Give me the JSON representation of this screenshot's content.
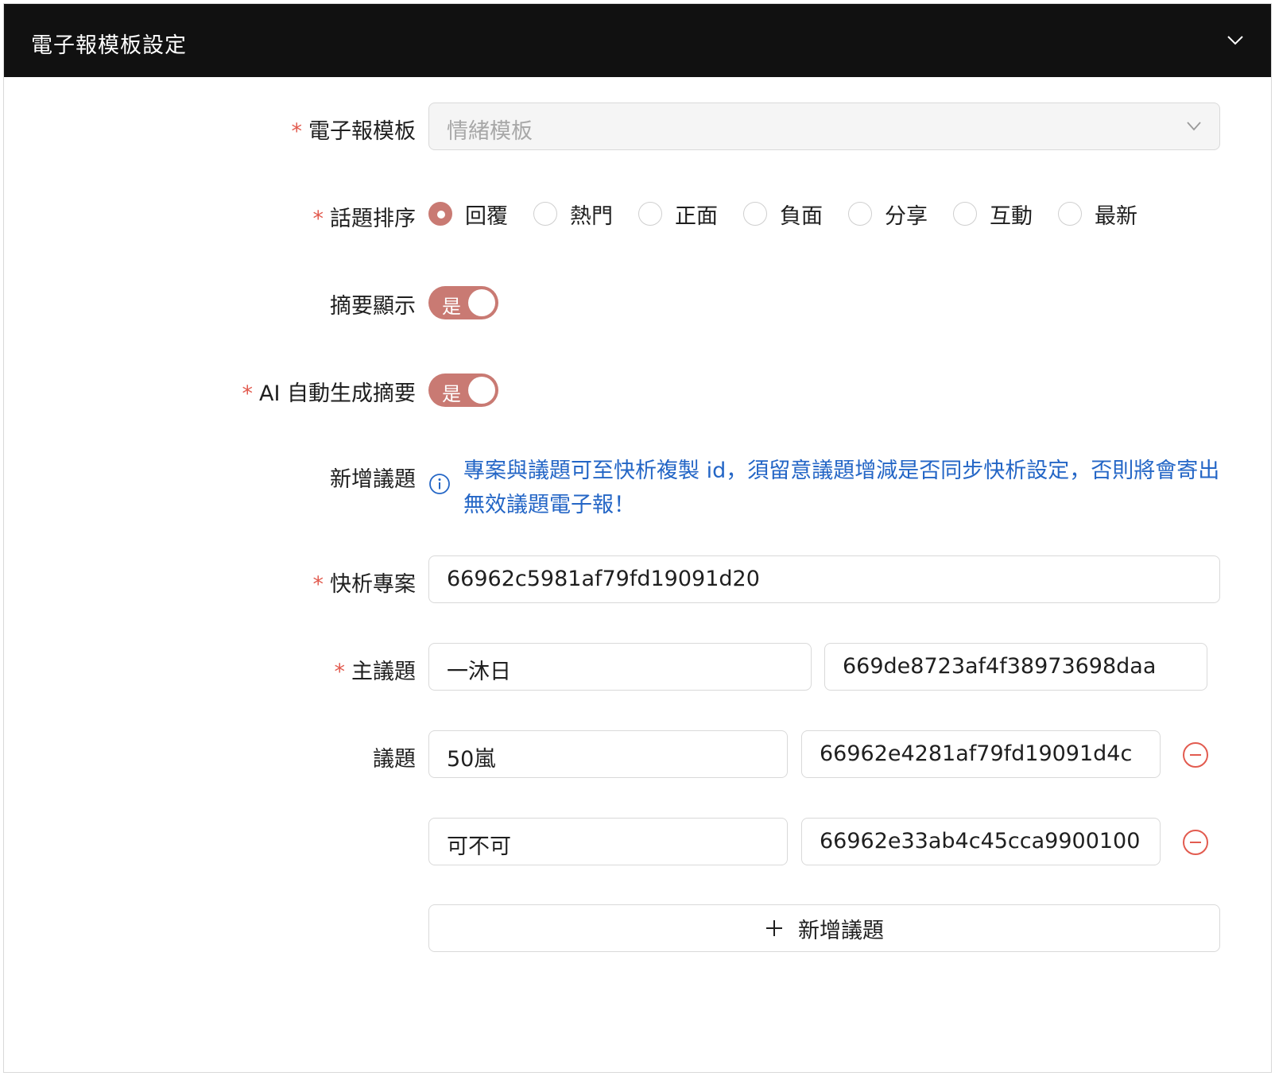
{
  "header": {
    "title": "電子報模板設定"
  },
  "form": {
    "template": {
      "label": "電子報模板",
      "value": "情緒模板"
    },
    "sort": {
      "label": "話題排序",
      "options": [
        "回覆",
        "熱門",
        "正面",
        "負面",
        "分享",
        "互動",
        "最新"
      ],
      "selected": "回覆"
    },
    "summary_display": {
      "label": "摘要顯示",
      "switch_text": "是"
    },
    "ai_summary": {
      "label": "AI 自動生成摘要",
      "switch_text": "是"
    },
    "add_topic_note": {
      "label": "新增議題",
      "text": "專案與議題可至快析複製 id，須留意議題增減是否同步快析設定，否則將會寄出無效議題電子報！"
    },
    "project": {
      "label": "快析專案",
      "value": "66962c5981af79fd19091d20"
    },
    "main_topic": {
      "label": "主議題",
      "name": "一沐日",
      "id": "669de8723af4f38973698daa"
    },
    "topics": {
      "label": "議題",
      "items": [
        {
          "name": "50嵐",
          "id": "66962e4281af79fd19091d4c"
        },
        {
          "name": "可不可",
          "id": "66962e33ab4c45cca9900100"
        }
      ]
    },
    "add_button": {
      "label": "新增議題"
    }
  },
  "colors": {
    "accent": "#c97a73",
    "required": "#e25b4f",
    "info": "#2466c6",
    "header_bg": "#111111"
  }
}
